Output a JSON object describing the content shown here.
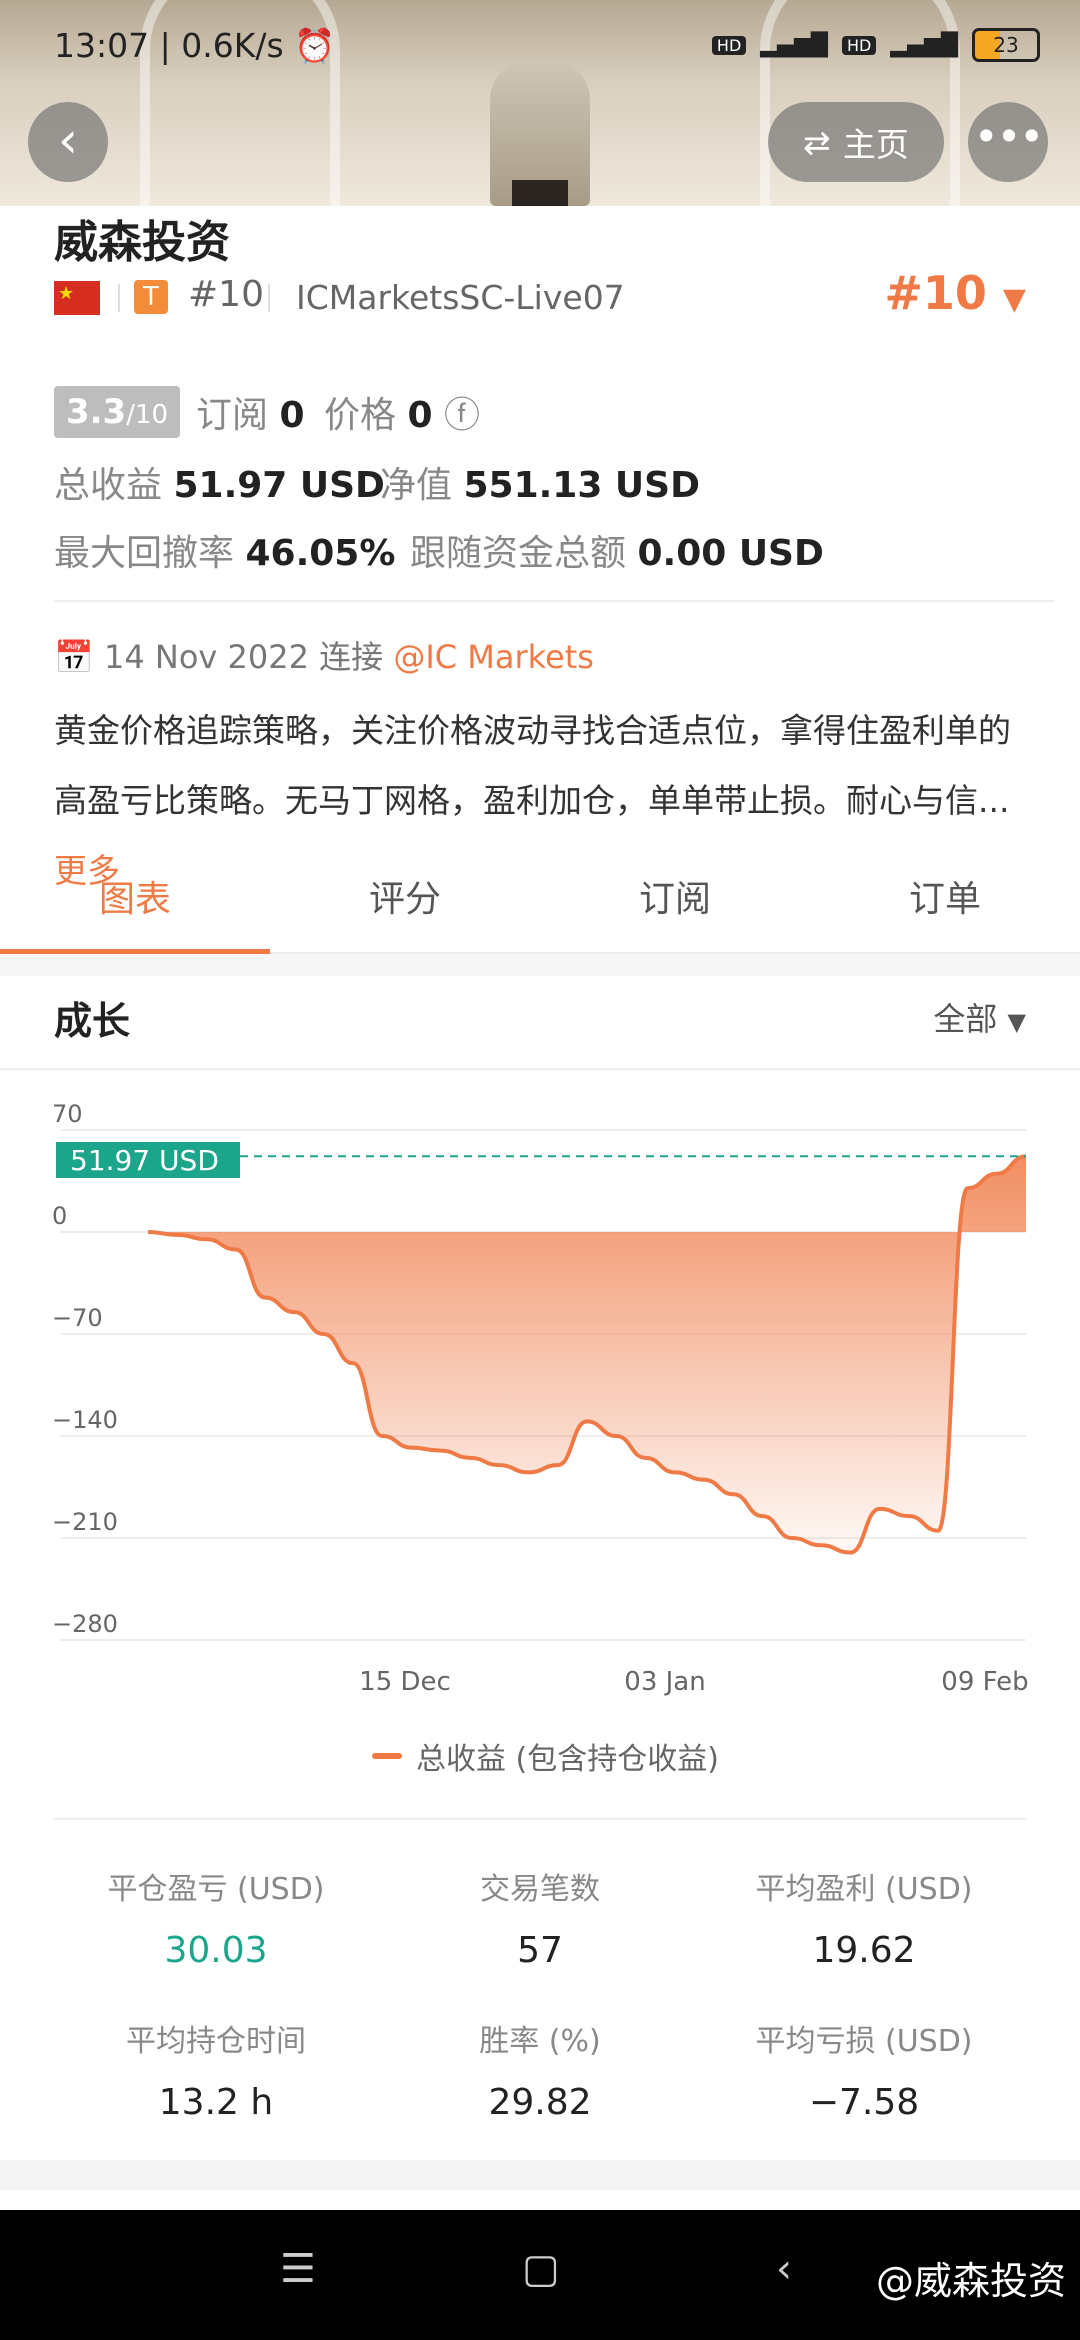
{
  "status_bar": {
    "time": "13:07",
    "speed": "0.6K/s",
    "net1": "HD",
    "net2": "HD",
    "battery": "23"
  },
  "header": {
    "home_label": "主页"
  },
  "profile": {
    "name": "威森投资",
    "tier_badge": "T",
    "rank_small": "#10",
    "server": "ICMarketsSC-Live07",
    "rank_big": "#10"
  },
  "stats": {
    "score": "3.3",
    "score_max": "/10",
    "subscribe_label": "订阅",
    "subscribe_value": "0",
    "price_label": "价格",
    "price_value": "0",
    "total_profit_label": "总收益",
    "total_profit_value": "51.97 USD",
    "equity_label": "净值",
    "equity_value": "551.13 USD",
    "drawdown_label": "最大回撤率",
    "drawdown_value": "46.05%",
    "follow_label": "跟随资金总额",
    "follow_value": "0.00 USD"
  },
  "connect": {
    "date": "14 Nov 2022 连接",
    "broker": "@IC Markets"
  },
  "description": {
    "text": "黄金价格追踪策略，关注价格波动寻找合适点位，拿得住盈利单的高盈亏比策略。无马丁网格，盈利加仓，单单带止损。耐心与信...",
    "more": "更多"
  },
  "tabs": [
    "图表",
    "评分",
    "订阅",
    "订单"
  ],
  "section": {
    "title": "成长",
    "filter": "全部"
  },
  "chart_data": {
    "type": "area",
    "current_label": "51.97 USD",
    "y_ticks": [
      70,
      0,
      -70,
      -140,
      -210,
      -280
    ],
    "x_ticks": [
      "15 Dec",
      "03 Jan",
      "09 Feb"
    ],
    "series": [
      {
        "name": "总收益 (包含持仓收益)",
        "values": [
          0,
          -2,
          -5,
          -12,
          -45,
          -55,
          -70,
          -90,
          -140,
          -148,
          -150,
          -155,
          -160,
          -165,
          -160,
          -130,
          -140,
          -155,
          -165,
          -170,
          -180,
          -195,
          -210,
          -215,
          -220,
          -190,
          -195,
          -205,
          30,
          40,
          52
        ]
      }
    ],
    "ylim": [
      -280,
      70
    ]
  },
  "legend": "总收益 (包含持仓收益)",
  "metrics": [
    {
      "label": "平仓盈亏 (USD)",
      "value": "30.03"
    },
    {
      "label": "交易笔数",
      "value": "57"
    },
    {
      "label": "平均盈利 (USD)",
      "value": "19.62"
    },
    {
      "label": "平均持仓时间",
      "value": "13.2 h"
    },
    {
      "label": "胜率 (%)",
      "value": "29.82"
    },
    {
      "label": "平均亏损 (USD)",
      "value": "−7.58"
    }
  ],
  "navbar": {
    "watermark": "@威森投资"
  },
  "colors": {
    "accent": "#ef7a46",
    "green": "#1ba58a"
  }
}
